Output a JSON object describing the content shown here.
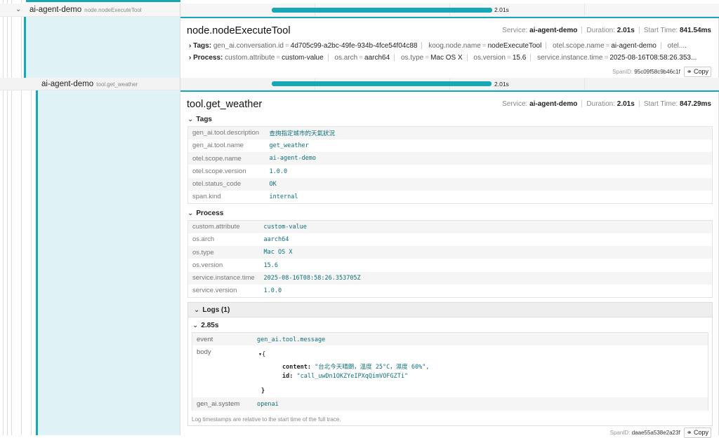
{
  "row1": {
    "service": "ai-agent-demo",
    "operation": "node.nodeExecuteTool",
    "duration_label": "2.01s",
    "duration_s": 2.01
  },
  "detail1": {
    "title": "node.nodeExecuteTool",
    "service_label": "Service:",
    "service": "ai-agent-demo",
    "duration_label": "Duration:",
    "duration": "2.01s",
    "start_label": "Start Time:",
    "start": "841.54ms",
    "tags_label": "Tags:",
    "tags": [
      {
        "k": "gen_ai.conversation.id",
        "v": "4d705c99-a2bc-49fe-934b-4fce54f04c88"
      },
      {
        "k": "koog.node.name",
        "v": "nodeExecuteTool"
      },
      {
        "k": "otel.scope.name",
        "v": "ai-agent-demo"
      },
      {
        "k": "otel....",
        "v": ""
      }
    ],
    "process_label": "Process:",
    "process": [
      {
        "k": "custom.attribute",
        "v": "custom-value"
      },
      {
        "k": "os.arch",
        "v": "aarch64"
      },
      {
        "k": "os.type",
        "v": "Mac OS X"
      },
      {
        "k": "os.version",
        "v": "15.6"
      },
      {
        "k": "service.instance.time",
        "v": "2025-08-16T08:58:26.353..."
      }
    ],
    "spanid_label": "SpanID:",
    "spanid": "95c09f58c9b46c1f",
    "copy_label": "Copy"
  },
  "row2": {
    "service": "ai-agent-demo",
    "operation": "tool.get_weather",
    "duration_label": "2.01s",
    "duration_s": 2.01
  },
  "detail2": {
    "title": "tool.get_weather",
    "service_label": "Service:",
    "service": "ai-agent-demo",
    "duration_label": "Duration:",
    "duration": "2.01s",
    "start_label": "Start Time:",
    "start": "847.29ms",
    "tags_title": "Tags",
    "tags": [
      {
        "k": "gen_ai.tool.description",
        "v": "查詢指定城市的天氣狀況"
      },
      {
        "k": "gen_ai.tool.name",
        "v": "get_weather"
      },
      {
        "k": "otel.scope.name",
        "v": "ai-agent-demo"
      },
      {
        "k": "otel.scope.version",
        "v": "1.0.0"
      },
      {
        "k": "otel.status_code",
        "v": "OK"
      },
      {
        "k": "span.kind",
        "v": "internal"
      }
    ],
    "process_title": "Process",
    "process": [
      {
        "k": "custom.attribute",
        "v": "custom-value"
      },
      {
        "k": "os.arch",
        "v": "aarch64"
      },
      {
        "k": "os.type",
        "v": "Mac OS X"
      },
      {
        "k": "os.version",
        "v": "15.6"
      },
      {
        "k": "service.instance.time",
        "v": "2025-08-16T08:58:26.353705Z"
      },
      {
        "k": "service.version",
        "v": "1.0.0"
      }
    ],
    "logs_title": "Logs (1)",
    "log": {
      "time": "2.85s",
      "event_key": "event",
      "event_value": "gen_ai.tool.message",
      "body_key": "body",
      "body_open": "▾{",
      "content_key": "content:",
      "content_value": "\"台北今天晴朗，溫度 25°C，濕度 60%\",",
      "id_key": "id:",
      "id_value": "\"call_uwDn1OKZYeIPXqQimVOFGZTi\"",
      "body_close": "}",
      "system_key": "gen_ai.system",
      "system_value": "openai"
    },
    "logs_note": "Log timestamps are relative to the start time of the full trace.",
    "spanid_label": "SpanID:",
    "spanid": "daae55a538e2a23f",
    "copy_label": "Copy"
  },
  "colors": {
    "accent": "#17a8b8",
    "stripe": "#dff2f5",
    "value_text": "#0c6f7a"
  },
  "icons": {
    "expand": "chevron-down-icon",
    "collapsed": "chevron-right-icon",
    "link": "link-icon"
  }
}
